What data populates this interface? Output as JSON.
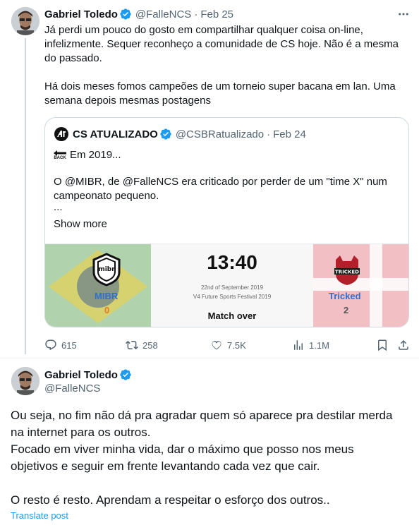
{
  "tweet1": {
    "author_name": "Gabriel Toledo",
    "handle": "@FalleNCS",
    "date": "Feb 25",
    "lines": [
      "Já perdi um pouco do gosto em compartilhar qualquer coisa on-line,",
      "infelizmente. Sequer reconheço a comunidade de CS hoje. Não é a mesma",
      "do passado.",
      "Há dois meses fomos campeões de um torneio super bacana em lan. Uma",
      "semana depois mesmas postagens"
    ],
    "more_icon": "more-dots-icon"
  },
  "quote": {
    "author_name": "CS ATUALIZADO",
    "handle": "@CSBRatualizado",
    "date": "Feb 24",
    "back_badge": "BACK",
    "intro": "Em 2019...",
    "lines": [
      "O @MIBR, de @FalleNCS era criticado por perder de um \"time X\" num",
      "campeonato pequeno.",
      "..."
    ],
    "show_more": "Show more"
  },
  "match": {
    "time": "13:40",
    "date": "22nd of September 2019",
    "event": "V4 Future Sports Festival 2019",
    "status": "Match over",
    "team1": {
      "name": "MIBR",
      "score": "0",
      "logo_text": "mibr"
    },
    "team2": {
      "name": "Tricked",
      "score": "2",
      "logo_text": "TRICKED"
    },
    "colors": {
      "team_blue": "#2f6fd0",
      "score_orange": "#e87722",
      "brazil_green": "#4a9d46",
      "brazil_yellow": "#f4d23c"
    }
  },
  "actions": {
    "replies": "615",
    "reposts": "258",
    "likes": "7.5K",
    "views": "1.1M"
  },
  "tweet2": {
    "author_name": "Gabriel Toledo",
    "handle": "@FalleNCS",
    "lines": [
      "Ou seja, no fim não dá pra agradar quem só aparece pra destilar merda",
      "na internet para os outros.",
      "Focado em viver minha vida, dar o máximo que posso nos meus",
      "objetivos e seguir em frente levantando cada vez que cair.",
      "O resto é resto. Aprendam a respeitar o esforço dos outros.."
    ],
    "translate": "Translate post"
  },
  "colors": {
    "accent": "#1d9bf0",
    "muted": "#536471",
    "border": "#cfd9de"
  }
}
